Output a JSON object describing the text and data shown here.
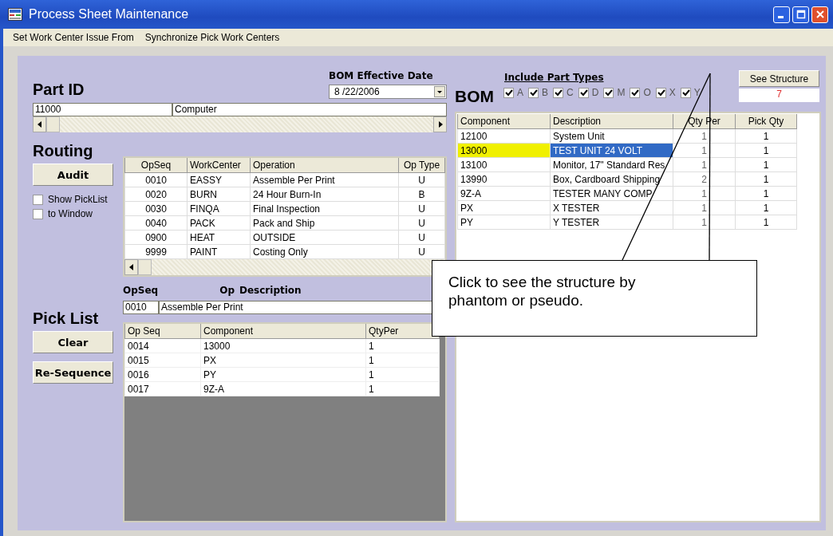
{
  "window": {
    "title": "Process Sheet Maintenance"
  },
  "menu": [
    "Set Work Center Issue From",
    "Synchronize Pick Work Centers"
  ],
  "part": {
    "heading": "Part ID",
    "id": "11000",
    "description": "Computer"
  },
  "bom_date": {
    "label": "BOM Effective Date",
    "value": "8 /22/2006"
  },
  "routing": {
    "heading": "Routing",
    "button": "Audit",
    "options": [
      {
        "label": "Show PickList",
        "checked": false
      },
      {
        "label": "to Window",
        "checked": false
      }
    ],
    "columns": [
      "OpSeq",
      "WorkCenter",
      "Operation",
      "Op Type"
    ],
    "rows": [
      {
        "cells": [
          "0010",
          "EASSY",
          "Assemble Per Print",
          "U"
        ]
      },
      {
        "cells": [
          "0020",
          "BURN",
          "24 Hour Burn-In",
          "B"
        ]
      },
      {
        "cells": [
          "0030",
          "FINQA",
          "Final Inspection",
          "U"
        ]
      },
      {
        "cells": [
          "0040",
          "PACK",
          "Pack and Ship",
          "U"
        ]
      },
      {
        "cells": [
          "0900",
          "HEAT",
          "OUTSIDE",
          "U"
        ]
      },
      {
        "cells": [
          "9999",
          "PAINT",
          "Costing Only",
          "U"
        ]
      }
    ]
  },
  "operation": {
    "seq_label": "OpSeq",
    "op_label": "Op",
    "desc_label": "Description",
    "seq": "0010",
    "description": "Assemble Per Print"
  },
  "pick_list": {
    "heading": "Pick List",
    "buttons": [
      "Clear",
      "Re-Sequence"
    ],
    "columns": [
      "Op Seq",
      "Component",
      "QtyPer"
    ],
    "rows": [
      [
        "0014",
        "13000",
        "1"
      ],
      [
        "0015",
        "PX",
        "1"
      ],
      [
        "0016",
        "PY",
        "1"
      ],
      [
        "0017",
        "9Z-A",
        "1"
      ]
    ]
  },
  "bom": {
    "heading": "BOM",
    "include_label": "Include Part Types",
    "see_structure": "See Structure",
    "count": "7",
    "part_types": [
      {
        "label": "A",
        "checked": true
      },
      {
        "label": "B",
        "checked": true
      },
      {
        "label": "C",
        "checked": true
      },
      {
        "label": "D",
        "checked": true
      },
      {
        "label": "M",
        "checked": true
      },
      {
        "label": "O",
        "checked": true
      },
      {
        "label": "X",
        "checked": true
      },
      {
        "label": "Y",
        "checked": true
      }
    ],
    "columns": [
      "Component",
      "Description",
      "Qty Per",
      "Pick Qty"
    ],
    "rows": [
      {
        "cells": [
          "12100",
          "System Unit",
          "1",
          "1"
        ],
        "selected": false
      },
      {
        "cells": [
          "13000",
          "TEST UNIT 24 VOLT",
          "1",
          "1"
        ],
        "selected": true
      },
      {
        "cells": [
          "13100",
          "Monitor, 17\" Standard Res",
          "1",
          "1"
        ],
        "selected": false
      },
      {
        "cells": [
          "13990",
          "Box, Cardboard Shipping",
          "2",
          "1"
        ],
        "selected": false
      },
      {
        "cells": [
          "9Z-A",
          "TESTER MANY COMP",
          "1",
          "1"
        ],
        "selected": false
      },
      {
        "cells": [
          "PX",
          "X TESTER",
          "1",
          "1"
        ],
        "selected": false
      },
      {
        "cells": [
          "PY",
          "Y TESTER",
          "1",
          "1"
        ],
        "selected": false
      }
    ]
  },
  "callout": {
    "text": "Click to see the structure by phantom or pseudo."
  }
}
